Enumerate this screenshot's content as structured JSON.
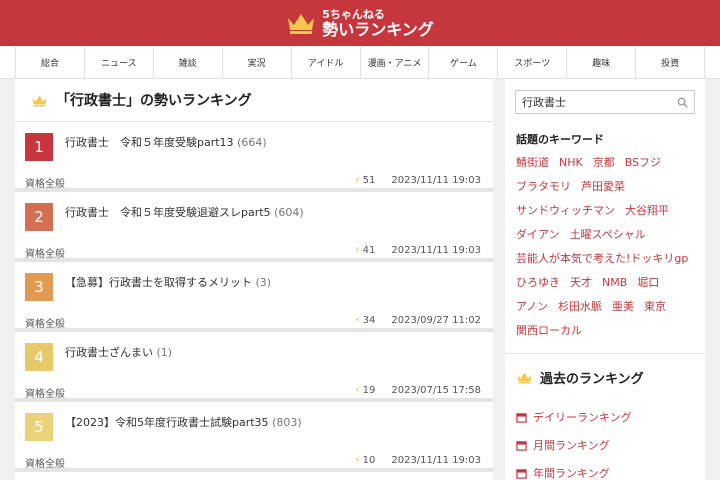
{
  "colors": {
    "brand": "#c5373d",
    "rank1": "#c5373d",
    "rank2": "#d36f52",
    "rank3": "#e09a52",
    "rank4": "#e8c96a",
    "rank5": "#ebd27a"
  },
  "header": {
    "logo_small": "5ちゃんねる",
    "logo_big": "勢いランキング"
  },
  "nav": [
    "総合",
    "ニュース",
    "雑談",
    "実況",
    "アイドル",
    "漫画・アニメ",
    "ゲーム",
    "スポーツ",
    "趣味",
    "投資"
  ],
  "main": {
    "title": "「行政書士」の勢いランキング",
    "items": [
      {
        "rank": "1",
        "title": "行政書士　令和５年度受験part13",
        "count": "(664)",
        "category": "資格全般",
        "momentum": "51",
        "date": "2023/11/11 19:03"
      },
      {
        "rank": "2",
        "title": "行政書士　令和５年度受験退避スレpart5",
        "count": "(604)",
        "category": "資格全般",
        "momentum": "41",
        "date": "2023/11/11 19:03"
      },
      {
        "rank": "3",
        "title": "【急募】行政書士を取得するメリット",
        "count": "(3)",
        "category": "資格全般",
        "momentum": "34",
        "date": "2023/09/27 11:02"
      },
      {
        "rank": "4",
        "title": "行政書士ざんまい",
        "count": "(1)",
        "category": "資格全般",
        "momentum": "19",
        "date": "2023/07/15 17:58"
      },
      {
        "rank": "5",
        "title": "【2023】令和5年度行政書士試験part35",
        "count": "(803)",
        "category": "資格全般",
        "momentum": "10",
        "date": "2023/11/11 19:03"
      }
    ]
  },
  "sidebar": {
    "search_value": "行政書士",
    "keywords_title": "話題のキーワード",
    "keywords": [
      "鯖街道",
      "NHK",
      "京都",
      "BSフジ",
      "ブラタモリ",
      "芦田愛菜",
      "サンドウィッチマン",
      "大谷翔平",
      "ダイアン",
      "土曜スペシャル",
      "芸能人が本気で考えた!ドッキリgp",
      "ひろゆき",
      "天才",
      "NMB",
      "堀口",
      "アノン",
      "杉田水脈",
      "亜美",
      "東京",
      "関西ローカル"
    ],
    "past_title": "過去のランキング",
    "past_items": [
      "デイリーランキング",
      "月間ランキング",
      "年間ランキング"
    ]
  }
}
